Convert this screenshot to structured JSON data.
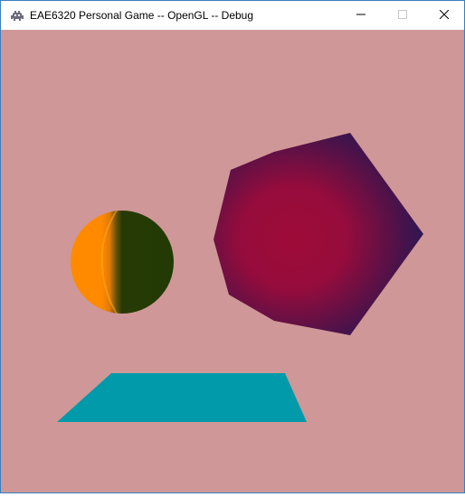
{
  "window": {
    "title": "EAE6320 Personal Game -- OpenGL -- Debug",
    "controls": {
      "minimize": "minimize-icon",
      "maximize": "maximize-icon",
      "close": "close-icon"
    }
  },
  "scene": {
    "clear_color": "#cf9797",
    "objects": [
      {
        "name": "sphere",
        "colors": [
          "#ff8800",
          "#233a05"
        ]
      },
      {
        "name": "heptagon",
        "colors": [
          "#9a0b3a",
          "#14195e"
        ]
      },
      {
        "name": "trapezoid",
        "colors": [
          "#009aaa"
        ]
      }
    ]
  }
}
